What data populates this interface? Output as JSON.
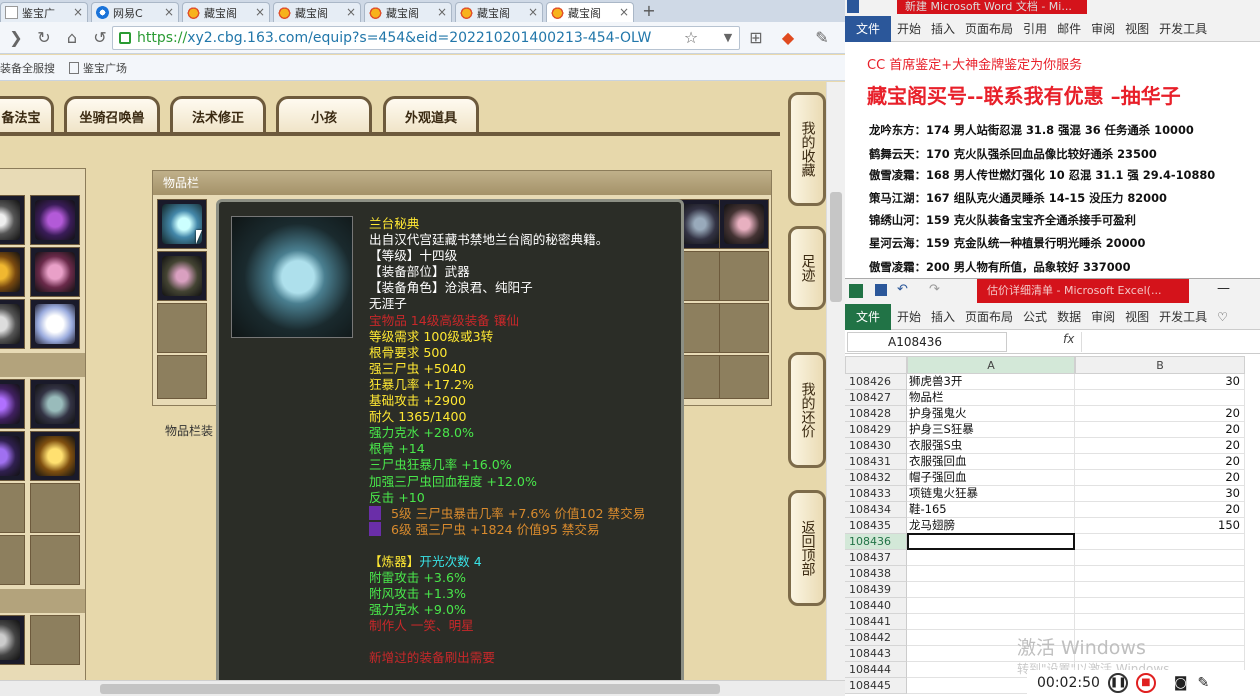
{
  "browser": {
    "tabs": [
      {
        "label": "鉴宝广",
        "icon": "page-icon"
      },
      {
        "label": "网易C",
        "icon": "netease-icon"
      },
      {
        "label": "藏宝阁",
        "icon": "sheep-icon"
      },
      {
        "label": "藏宝阁",
        "icon": "sheep-icon"
      },
      {
        "label": "藏宝阁",
        "icon": "sheep-icon"
      },
      {
        "label": "藏宝阁",
        "icon": "sheep-icon"
      },
      {
        "label": "藏宝阁",
        "icon": "sheep-icon"
      }
    ],
    "tab_close": "×",
    "new_tab": "+",
    "url_scheme": "https://",
    "url_rest": "xy2.cbg.163.com/equip?s=454&eid=202210201400213-454-OLW",
    "bookmarks": [
      "装备全服搜",
      "鉴宝广场"
    ]
  },
  "game": {
    "tabs": [
      "备法宝",
      "坐骑召唤兽",
      "法术修正",
      "小孩",
      "外观道具"
    ],
    "inventory_title": "物品栏",
    "inventory_footer": "物品栏装",
    "side_buttons": [
      "我的收藏",
      "足迹",
      "我的还价",
      "返回顶部"
    ]
  },
  "tooltip": {
    "name": "兰台秘典",
    "desc": "出自汉代宫廷藏书禁地兰台阁的秘密典籍。",
    "level": "【等级】十四级",
    "slot": "【装备部位】武器",
    "role": "【装备角色】沧浪君、纯阳子",
    "nonetrans": "无涯子",
    "jewel": "宝物品 14级高级装备 镶仙",
    "req": "等级需求 100级或3转",
    "bone": "根骨要求 500",
    "stats": [
      "强三尸虫 +5040",
      "狂暴几率 +17.2%",
      "基础攻击 +2900",
      "耐久 1365/1400"
    ],
    "green": [
      "强力克水 +28.0%",
      "根骨 +14",
      "三尸虫狂暴几率 +16.0%",
      "加强三尸虫回血程度 +12.0%",
      "反击 +10"
    ],
    "gems": [
      "5级 三尸虫暴击几率 +7.6% 价值102 禁交易",
      "6级 强三尸虫 +1824 价值95 禁交易"
    ],
    "refine_label": "【炼器】",
    "refine_count": "开光次数 4",
    "refine": [
      "附雷攻击 +3.6%",
      "附风攻击 +1.3%",
      "强力克水 +9.0%"
    ],
    "maker": "制作人 一笑、明星",
    "bottom": "新增过的装备刷出需要"
  },
  "word": {
    "title": "新建 Microsoft Word 文档 - Mi...",
    "file_btn": "文件",
    "ribbon": [
      "开始",
      "插入",
      "页面布局",
      "引用",
      "邮件",
      "审阅",
      "视图",
      "开发工具"
    ],
    "line1": "CC 首席鉴定+大神金牌鉴定为你服务",
    "line2": "藏宝阁买号--联系我有优惠 –抽华子",
    "entries": [
      "龙吟东方：174 男人站街忍混 31.8 强混 36 任务通杀 10000",
      "鹤舞云天：170 克火队强杀回血品像比较好通杀 23500",
      "傲雪凌霜：168 男人传世燃灯强化 10 忍混 31.1 强 29.4-10880",
      "策马江湖：167 组队克火通灵睡杀 14-15 没压力 82000",
      "锦绣山河：159 克火队装备宝宝齐全通杀接手可盈利",
      "星河云海：159 克金队统一种植景行明光睡杀 20000",
      "傲雪凌霜：200 男人物有所值，品象较好 337000"
    ]
  },
  "excel": {
    "title": "估价详细清单 - Microsoft Excel(...",
    "file_btn": "文件",
    "ribbon": [
      "开始",
      "插入",
      "页面布局",
      "公式",
      "数据",
      "审阅",
      "视图",
      "开发工具"
    ],
    "name_box": "A108436",
    "fx": "fx",
    "col_a": "A",
    "col_b": "B",
    "rows": [
      {
        "n": "108426",
        "a": "狮虎兽3开",
        "b": "30"
      },
      {
        "n": "108427",
        "a": "物品栏",
        "b": ""
      },
      {
        "n": "108428",
        "a": "护身强鬼火",
        "b": "20"
      },
      {
        "n": "108429",
        "a": "护身三S狂暴",
        "b": "20"
      },
      {
        "n": "108430",
        "a": "衣服强S虫",
        "b": "20"
      },
      {
        "n": "108431",
        "a": "衣服强回血",
        "b": "20"
      },
      {
        "n": "108432",
        "a": "帽子强回血",
        "b": "20"
      },
      {
        "n": "108433",
        "a": "项链鬼火狂暴",
        "b": "30"
      },
      {
        "n": "108434",
        "a": "鞋-165",
        "b": "20"
      },
      {
        "n": "108435",
        "a": "龙马翅膀",
        "b": "150"
      },
      {
        "n": "108436",
        "a": "",
        "b": ""
      },
      {
        "n": "108437",
        "a": "",
        "b": ""
      },
      {
        "n": "108438",
        "a": "",
        "b": ""
      },
      {
        "n": "108439",
        "a": "",
        "b": ""
      },
      {
        "n": "108440",
        "a": "",
        "b": ""
      },
      {
        "n": "108441",
        "a": "",
        "b": ""
      },
      {
        "n": "108442",
        "a": "",
        "b": ""
      },
      {
        "n": "108443",
        "a": "",
        "b": ""
      },
      {
        "n": "108444",
        "a": "",
        "b": ""
      },
      {
        "n": "108445",
        "a": "",
        "b": ""
      }
    ],
    "watermark": "激活 Windows",
    "watermark2": "转到\"设置\"以激活 Windows。",
    "timer": "00:02:50"
  }
}
